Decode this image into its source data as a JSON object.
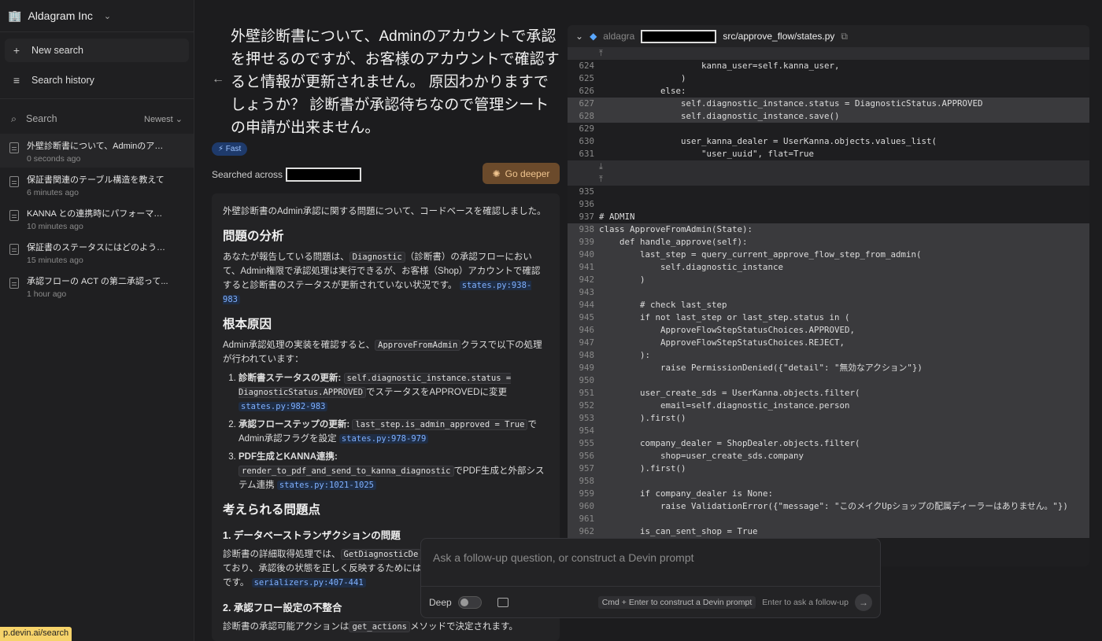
{
  "sidebar": {
    "org_name": "Aldagram Inc",
    "new_search": "New search",
    "search_history": "Search history",
    "search_label": "Search",
    "sort_label": "Newest",
    "items": [
      {
        "title": "外壁診断書について、Adminのアカ...",
        "time": "0 seconds ago"
      },
      {
        "title": "保証書関連のテーブル構造を教えて",
        "time": "6 minutes ago"
      },
      {
        "title": "KANNA との連携時にパフォーマン...",
        "time": "10 minutes ago"
      },
      {
        "title": "保証書のステータスにはどのような...",
        "time": "15 minutes ago"
      },
      {
        "title": "承認フローの ACT の第二承認って...",
        "time": "1 hour ago"
      }
    ],
    "url_tip": "p.devin.ai/search"
  },
  "main": {
    "question": "外壁診断書について、Adminのアカウントで承認を押せるのですが、お客様のアカウントで確認すると情報が更新されません。 原因わかりますでしょうか？ 診断書が承認待ちなので管理シートの申請が出来ません。",
    "badge": "⚡ Fast",
    "searched_across": "Searched across",
    "go_deeper": "Go deeper",
    "answer": {
      "intro": "外壁診断書のAdmin承認に関する問題について、コードベースを確認しました。",
      "h_analysis": "問題の分析",
      "p_analysis_1": "あなたが報告している問題は、",
      "p_analysis_code": "Diagnostic",
      "p_analysis_2": "（診断書）の承認フローにおいて、Admin権限で承認処理は実行できるが、お客様（Shop）アカウントで確認すると診断書のステータスが更新されていない状況です。",
      "p_analysis_ref": "states.py:938-983",
      "h_cause": "根本原因",
      "p_cause_1": "Admin承認処理の実装を確認すると、",
      "p_cause_code": "ApproveFromAdmin",
      "p_cause_2": "クラスで以下の処理が行われています：",
      "li1_bold": "診断書ステータスの更新:",
      "li1_code": "self.diagnostic_instance.status = DiagnosticStatus.APPROVED",
      "li1_text": "でステータスをAPPROVEDに変更",
      "li1_ref": "states.py:982-983",
      "li2_bold": "承認フローステップの更新:",
      "li2_code": "last_step.is_admin_approved = True",
      "li2_text": "でAdmin承認フラグを設定",
      "li2_ref": "states.py:978-979",
      "li3_bold": "PDF生成とKANNA連携:",
      "li3_code": "render_to_pdf_and_send_to_kanna_diagnostic",
      "li3_text": "でPDF生成と外部システム連携",
      "li3_ref": "states.py:1021-1025",
      "h_issues": "考えられる問題点",
      "h_issue1": "1. データベーストランザクションの問題",
      "p_issue1_1": "診断書の詳細取得処理では、",
      "p_issue1_code": "GetDiagnosticDe",
      "p_issue1_2": "ており、承認後の状態を正しく反映するためには",
      "p_issue1_3": "です。",
      "p_issue1_ref": "serializers.py:407-441",
      "h_issue2": "2. 承認フロー設定の不整合",
      "p_issue2_1": "診断書の承認可能アクションは",
      "p_issue2_code": "get_actions",
      "p_issue2_2": "メソッドで決定されます。"
    }
  },
  "code": {
    "repo": "aldagra",
    "path": "src/approve_flow/states.py",
    "lines": [
      {
        "n": "",
        "t": "⤒",
        "c": "hl"
      },
      {
        "n": "624",
        "t": "                    kanna_user=self.kanna_user,",
        "c": ""
      },
      {
        "n": "625",
        "t": "                )",
        "c": ""
      },
      {
        "n": "626",
        "t": "            else:",
        "c": ""
      },
      {
        "n": "627",
        "t": "                self.diagnostic_instance.status = DiagnosticStatus.APPROVED",
        "c": "sel"
      },
      {
        "n": "628",
        "t": "                self.diagnostic_instance.save()",
        "c": "sel"
      },
      {
        "n": "629",
        "t": "",
        "c": ""
      },
      {
        "n": "630",
        "t": "                user_kanna_dealer = UserKanna.objects.values_list(",
        "c": ""
      },
      {
        "n": "631",
        "t": "                    \"user_uuid\", flat=True",
        "c": ""
      },
      {
        "n": "",
        "t": "⤓",
        "c": "hl"
      },
      {
        "n": "",
        "t": "⤒",
        "c": "hl"
      },
      {
        "n": "935",
        "t": "",
        "c": ""
      },
      {
        "n": "936",
        "t": "",
        "c": ""
      },
      {
        "n": "937",
        "t": "# ADMIN",
        "c": ""
      },
      {
        "n": "938",
        "t": "class ApproveFromAdmin(State):",
        "c": "sel"
      },
      {
        "n": "939",
        "t": "    def handle_approve(self):",
        "c": "sel"
      },
      {
        "n": "940",
        "t": "        last_step = query_current_approve_flow_step_from_admin(",
        "c": "sel"
      },
      {
        "n": "941",
        "t": "            self.diagnostic_instance",
        "c": "sel"
      },
      {
        "n": "942",
        "t": "        )",
        "c": "sel"
      },
      {
        "n": "943",
        "t": "",
        "c": "sel"
      },
      {
        "n": "944",
        "t": "        # check last_step",
        "c": "sel"
      },
      {
        "n": "945",
        "t": "        if not last_step or last_step.status in (",
        "c": "sel"
      },
      {
        "n": "946",
        "t": "            ApproveFlowStepStatusChoices.APPROVED,",
        "c": "sel"
      },
      {
        "n": "947",
        "t": "            ApproveFlowStepStatusChoices.REJECT,",
        "c": "sel"
      },
      {
        "n": "948",
        "t": "        ):",
        "c": "sel"
      },
      {
        "n": "949",
        "t": "            raise PermissionDenied({\"detail\": \"無効なアクション\"})",
        "c": "sel"
      },
      {
        "n": "950",
        "t": "",
        "c": "sel"
      },
      {
        "n": "951",
        "t": "        user_create_sds = UserKanna.objects.filter(",
        "c": "sel"
      },
      {
        "n": "952",
        "t": "            email=self.diagnostic_instance.person",
        "c": "sel"
      },
      {
        "n": "953",
        "t": "        ).first()",
        "c": "sel"
      },
      {
        "n": "954",
        "t": "",
        "c": "sel"
      },
      {
        "n": "955",
        "t": "        company_dealer = ShopDealer.objects.filter(",
        "c": "sel"
      },
      {
        "n": "956",
        "t": "            shop=user_create_sds.company",
        "c": "sel"
      },
      {
        "n": "957",
        "t": "        ).first()",
        "c": "sel"
      },
      {
        "n": "958",
        "t": "",
        "c": "sel"
      },
      {
        "n": "959",
        "t": "        if company_dealer is None:",
        "c": "sel"
      },
      {
        "n": "960",
        "t": "            raise ValidationError({\"message\": \"このメイクUpショップの配属ディーラーはありません。\"})",
        "c": "sel"
      },
      {
        "n": "961",
        "t": "",
        "c": "sel"
      },
      {
        "n": "962",
        "t": "        is_can_sent_shop = True",
        "c": "sel"
      }
    ]
  },
  "followup": {
    "placeholder": "Ask a follow-up question, or construct a Devin prompt",
    "deep_label": "Deep",
    "hint_cmd": "Cmd + Enter to construct a Devin prompt",
    "hint_enter": "Enter to ask a follow-up"
  }
}
